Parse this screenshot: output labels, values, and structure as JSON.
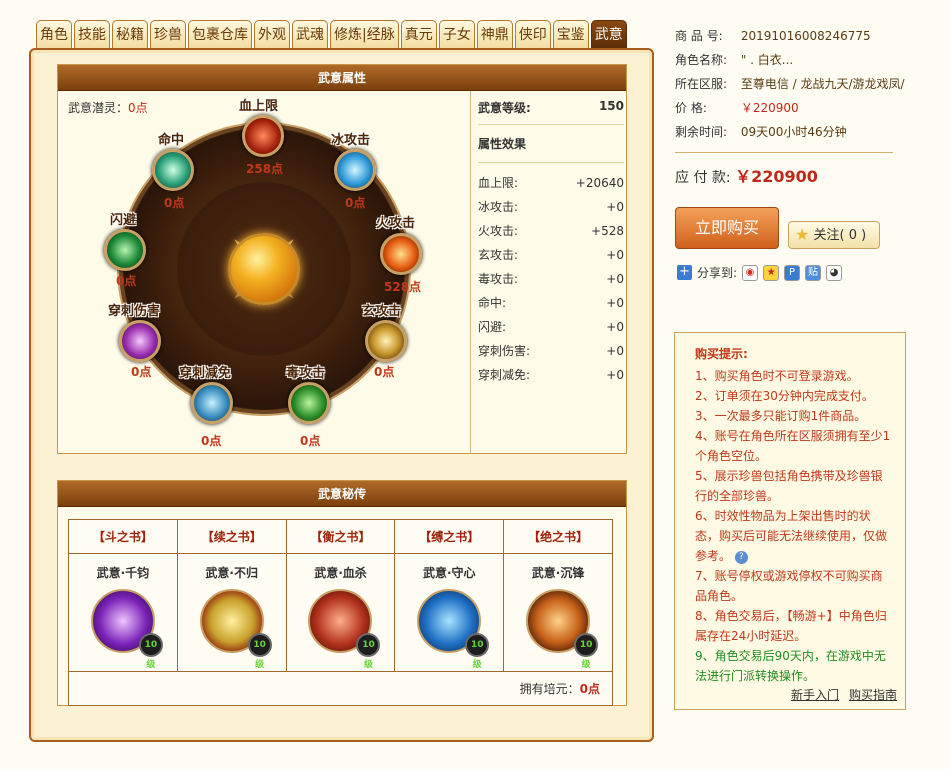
{
  "tabs": [
    "角色",
    "技能",
    "秘籍",
    "珍兽",
    "包裹仓库",
    "外观",
    "武魂",
    "修炼|经脉",
    "真元",
    "子女",
    "神鼎",
    "侠印",
    "宝鉴",
    "武意"
  ],
  "active_tab": "武意",
  "attributes_panel": {
    "title": "武意属性",
    "potential_label": "武意潜灵：",
    "potential_value": "0点",
    "nodes": [
      {
        "label": "血上限",
        "value": "258点"
      },
      {
        "label": "冰攻击",
        "value": "0点"
      },
      {
        "label": "火攻击",
        "value": "528点"
      },
      {
        "label": "玄攻击",
        "value": "0点"
      },
      {
        "label": "毒攻击",
        "value": "0点"
      },
      {
        "label": "穿刺减免",
        "value": "0点"
      },
      {
        "label": "穿刺伤害",
        "value": "0点"
      },
      {
        "label": "闪避",
        "value": "0点"
      },
      {
        "label": "命中",
        "value": "0点"
      }
    ],
    "level_label": "武意等级:",
    "level_value": "150",
    "effects_title": "属性效果",
    "effects": [
      {
        "name": "血上限:",
        "value": "+20640"
      },
      {
        "name": "冰攻击:",
        "value": "+0"
      },
      {
        "name": "火攻击:",
        "value": "+528"
      },
      {
        "name": "玄攻击:",
        "value": "+0"
      },
      {
        "name": "毒攻击:",
        "value": "+0"
      },
      {
        "name": "命中:",
        "value": "+0"
      },
      {
        "name": "闪避:",
        "value": "+0"
      },
      {
        "name": "穿刺伤害:",
        "value": "+0"
      },
      {
        "name": "穿刺减免:",
        "value": "+0"
      }
    ]
  },
  "secrets_panel": {
    "title": "武意秘传",
    "books": [
      {
        "book": "【斗之书】",
        "name": "武意·千钧",
        "level": "10级"
      },
      {
        "book": "【续之书】",
        "name": "武意·不归",
        "level": "10级"
      },
      {
        "book": "【衡之书】",
        "name": "武意·血杀",
        "level": "10级"
      },
      {
        "book": "【缚之书】",
        "name": "武意·守心",
        "level": "10级"
      },
      {
        "book": "【绝之书】",
        "name": "武意·沉锋",
        "level": "10级"
      }
    ],
    "footer_label": "拥有培元：",
    "footer_value": "0点"
  },
  "item_info": {
    "id_label": "商 品 号:",
    "id_value": "20191016008246775",
    "role_label": "角色名称:",
    "role_value": "\" . 白衣...",
    "server_label": "所在区服:",
    "server_value": "至尊电信 / 龙战九天/游龙戏凤/...",
    "price_label": "价      格:",
    "price_value": "￥220900",
    "time_label": "剩余时间:",
    "time_value": "09天00小时46分钟",
    "pay_label": "应 付 款:",
    "pay_value": "￥220900"
  },
  "buttons": {
    "buy": "立即购买",
    "follow": "关注",
    "follow_count": "( 0 )",
    "share_label": "分享到:"
  },
  "tips": {
    "title": "购买提示:",
    "items": [
      "1、购买角色时不可登录游戏。",
      "2、订单须在30分钟内完成支付。",
      "3、一次最多只能订购1件商品。",
      "4、账号在角色所在区服须拥有至少1个角色空位。",
      "5、展示珍兽包括角色携带及珍兽银行的全部珍兽。",
      "6、时效性物品为上架出售时的状态，购买后可能无法继续使用，仅做参考。",
      "7、账号停权或游戏停权不可购买商品角色。",
      "8、角色交易后，【畅游+】中角色归属存在24小时延迟。"
    ],
    "green_item": "9、角色交易后90天内，在游戏中无法进行门派转换操作。",
    "link_newbie": "新手入门",
    "link_guide": "购买指南"
  },
  "colors": {
    "accent": "#c0281c",
    "panel_border": "#a85e1d",
    "header": "#7b3f0c"
  }
}
